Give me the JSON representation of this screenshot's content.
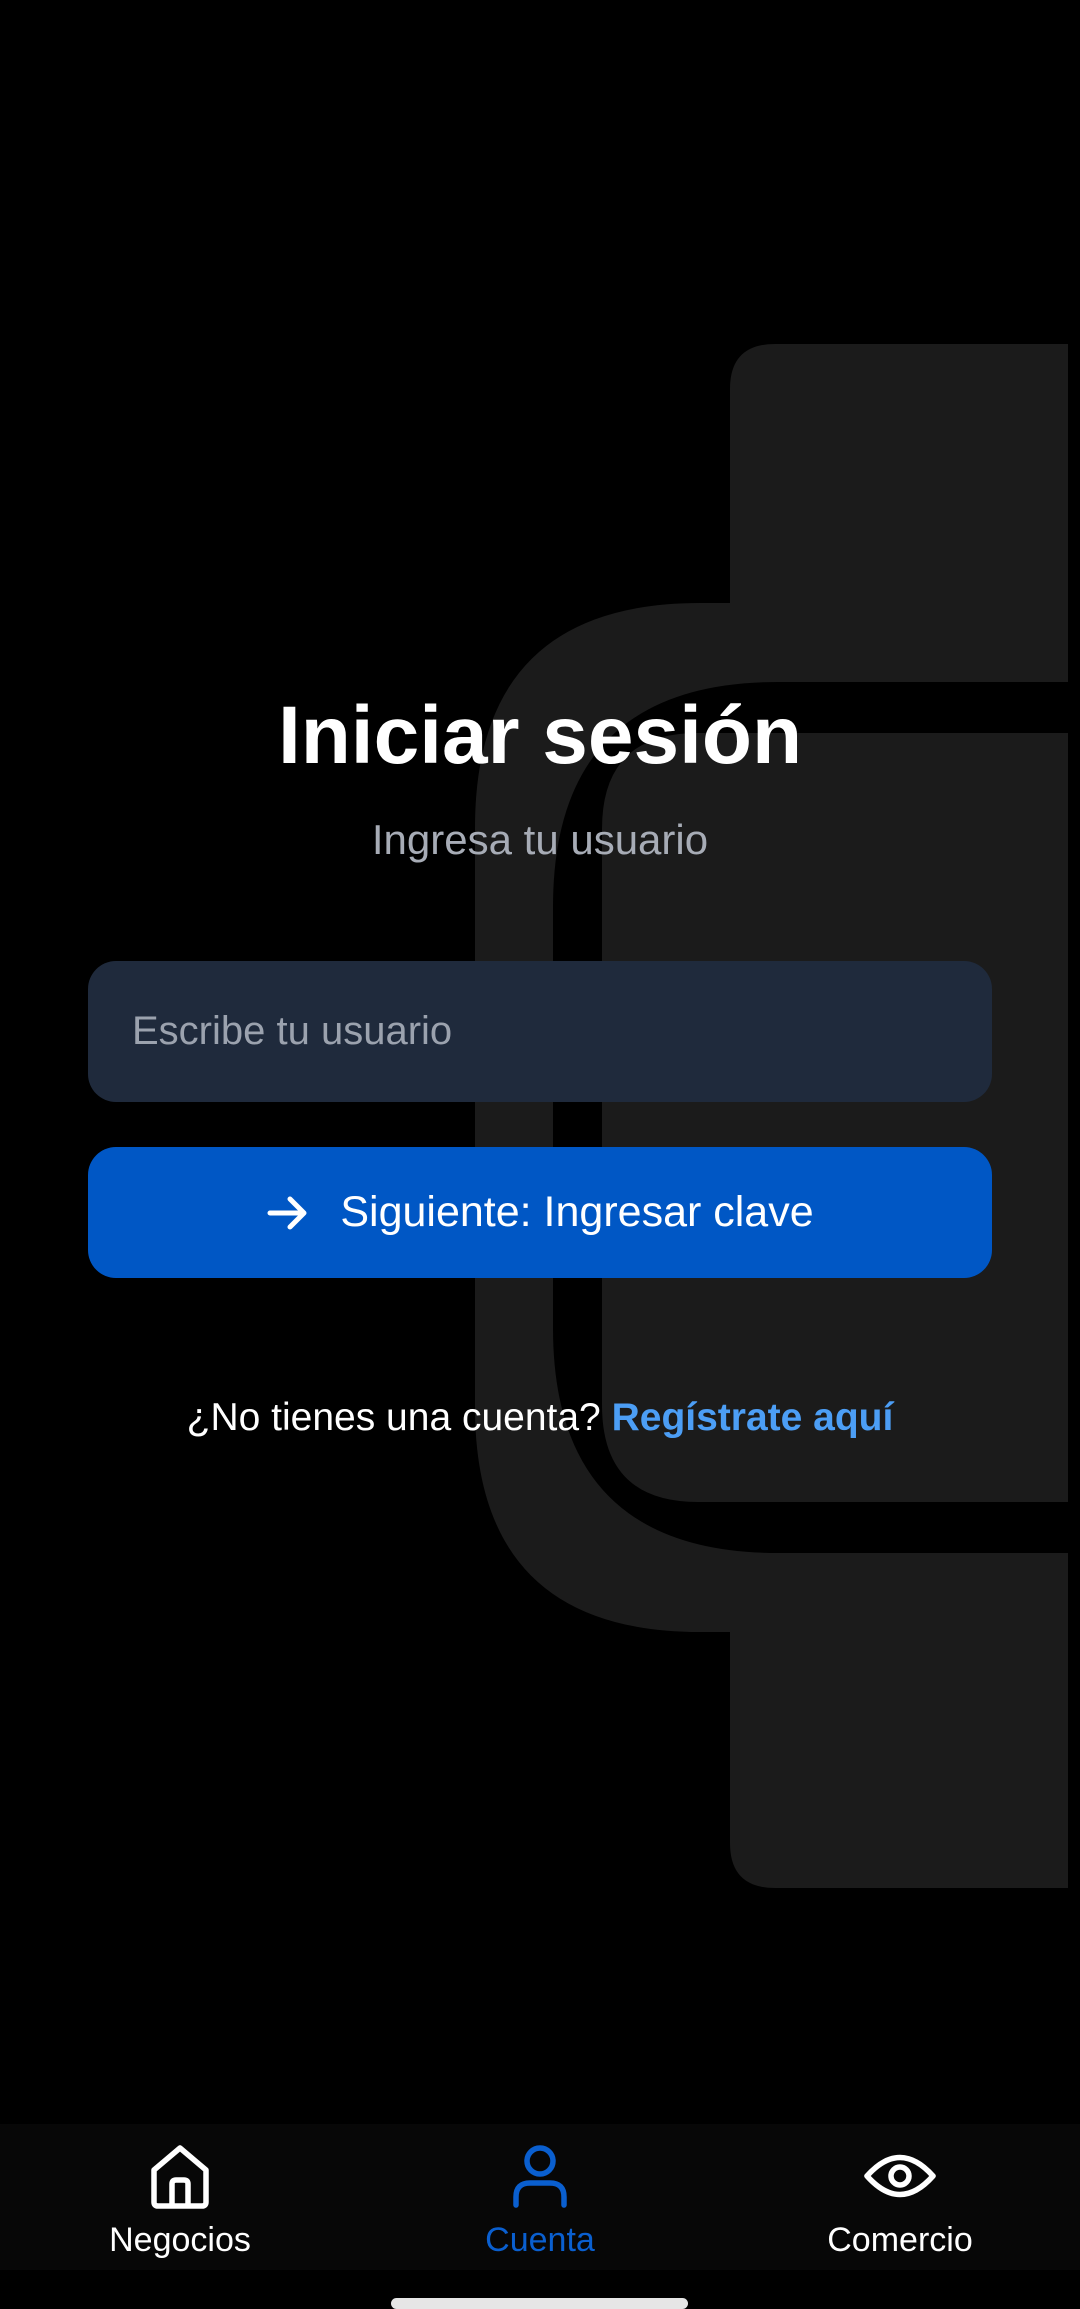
{
  "login": {
    "title": "Iniciar sesión",
    "subtitle": "Ingresa tu usuario",
    "username_placeholder": "Escribe tu usuario",
    "username_value": "",
    "next_button_label": "Siguiente: Ingresar clave",
    "no_account_text": "¿No tienes una cuenta?",
    "register_link_label": "Regístrate aquí"
  },
  "bottom_nav": {
    "items": [
      {
        "label": "Negocios",
        "icon": "home-icon",
        "active": false
      },
      {
        "label": "Cuenta",
        "icon": "person-icon",
        "active": true
      },
      {
        "label": "Comercio",
        "icon": "eye-icon",
        "active": false
      }
    ]
  },
  "colors": {
    "background": "#000000",
    "watermark": "#1b1b1b",
    "input_background": "#1f2a3c",
    "primary_button": "#0057c5",
    "link": "#4c9ef5",
    "active_nav": "#0a5fcf"
  },
  "icons": {
    "next_button": "arrow-right-icon",
    "background": "watermark-logo"
  }
}
